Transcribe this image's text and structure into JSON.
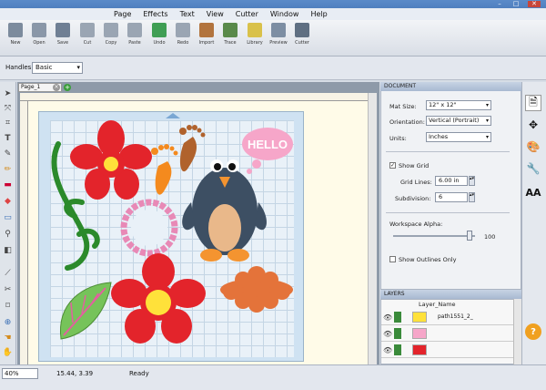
{
  "menu": [
    "Page",
    "Effects",
    "Text",
    "View",
    "Cutter",
    "Window",
    "Help"
  ],
  "window_controls": [
    "–",
    "□",
    "✕"
  ],
  "toolbar": [
    {
      "label": "New",
      "color": "#7c8b9d"
    },
    {
      "label": "Open",
      "color": "#8a97a8"
    },
    {
      "label": "Save",
      "color": "#6f7f94"
    },
    {
      "label": "Cut",
      "color": "#9aa5b3"
    },
    {
      "label": "Copy",
      "color": "#9aa5b3"
    },
    {
      "label": "Paste",
      "color": "#9aa5b3"
    },
    {
      "label": "Undo",
      "color": "#3f9e54"
    },
    {
      "label": "Redo",
      "color": "#9aa5b3"
    },
    {
      "label": "Import",
      "color": "#b2743e"
    },
    {
      "label": "Trace",
      "color": "#5a8a4a"
    },
    {
      "label": "Library",
      "color": "#d9c14a"
    },
    {
      "label": "Preview",
      "color": "#7d8ea3"
    },
    {
      "label": "Cutter",
      "color": "#5f6f82"
    }
  ],
  "handles": {
    "label": "Handles:",
    "value": "Basic"
  },
  "page_tab": "Page_1",
  "document": {
    "header": "DOCUMENT",
    "mat_size_label": "Mat Size:",
    "mat_size": "12\" x 12\"",
    "orientation_label": "Orientation:",
    "orientation": "Vertical (Portrait)",
    "units_label": "Units:",
    "units": "Inches",
    "show_grid": "Show Grid",
    "grid_lines_label": "Grid Lines:",
    "grid_lines": "6.00 in",
    "subdivision_label": "Subdivision:",
    "subdivision": "6",
    "workspace_alpha_label": "Workspace Alpha:",
    "workspace_alpha": "100",
    "show_outlines": "Show Outlines Only"
  },
  "layers": {
    "header": "LAYERS",
    "column": "Layer_Name",
    "rows": [
      {
        "name": "path1551_2_"
      },
      {
        "name": ""
      },
      {
        "name": ""
      }
    ]
  },
  "design": {
    "hello": "HELLO"
  },
  "status": {
    "zoom": "40%",
    "coords": "15.44, 3.39",
    "state": "Ready"
  },
  "colors": {
    "flower": "#e3242b",
    "center": "#ffe13a",
    "stem": "#2b8a2b",
    "penguin": "#3d4f63",
    "feet": "#f49430",
    "orange_foot": "#f48a1e",
    "brown_foot": "#b0622c",
    "pink": "#e889b6",
    "leaf": "#76c35a",
    "cloud": "#f6a6c9"
  }
}
